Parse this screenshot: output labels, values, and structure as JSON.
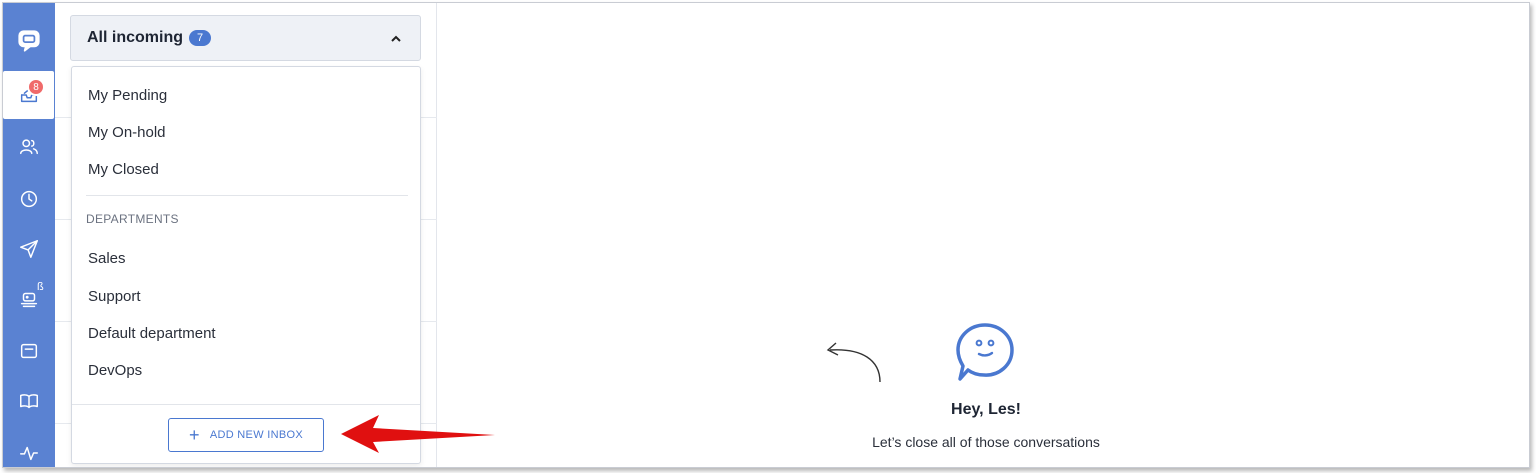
{
  "rail": {
    "inbox_badge": "8",
    "beta_mark": "ß"
  },
  "inbox": {
    "title": "All incoming",
    "count": "7",
    "personal": [
      "My Pending",
      "My On-hold",
      "My Closed"
    ],
    "departments_label": "DEPARTMENTS",
    "departments": [
      "Sales",
      "Support",
      "Default department",
      "DevOps"
    ],
    "add_button": "ADD NEW INBOX"
  },
  "empty_state": {
    "greeting": "Hey, Les!",
    "message": "Let’s close all of those conversations"
  },
  "colors": {
    "rail": "#5a82d2",
    "accent": "#4a78d0",
    "badge": "#f06a6a",
    "annotation_arrow": "#e01010"
  }
}
